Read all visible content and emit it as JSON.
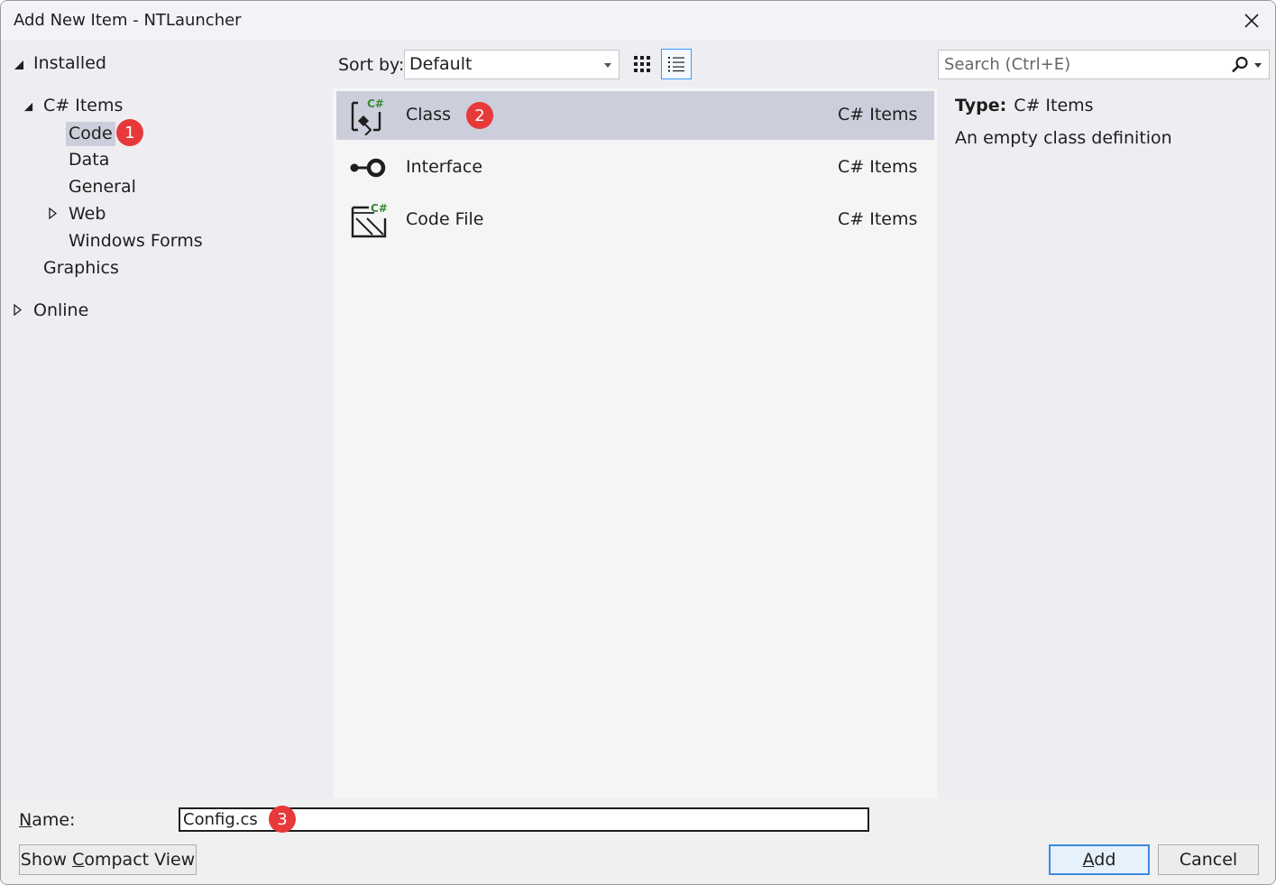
{
  "window": {
    "title": "Add New Item - NTLauncher"
  },
  "tree": {
    "installed": "Installed",
    "csharp_items": "C# Items",
    "code": "Code",
    "data": "Data",
    "general": "General",
    "web": "Web",
    "windows_forms": "Windows Forms",
    "graphics": "Graphics",
    "online": "Online"
  },
  "toolbar": {
    "sort_label": "Sort by:",
    "sort_value": "Default",
    "search_placeholder": "Search (Ctrl+E)"
  },
  "items": [
    {
      "name": "Class",
      "category": "C# Items",
      "icon": "class-icon",
      "selected": true
    },
    {
      "name": "Interface",
      "category": "C# Items",
      "icon": "interface-icon",
      "selected": false
    },
    {
      "name": "Code File",
      "category": "C# Items",
      "icon": "code-file-icon",
      "selected": false
    }
  ],
  "details": {
    "type_label": "Type:",
    "type_value": "C# Items",
    "description": "An empty class definition"
  },
  "footer": {
    "name_label": "Name:",
    "name_value": "Config.cs",
    "compact_view": "Show Compact View",
    "add": "Add",
    "cancel": "Cancel"
  },
  "badges": [
    "1",
    "2",
    "3"
  ],
  "colors": {
    "accent": "#3399ff",
    "selected_bg": "#cccedb",
    "badge": "#e8393a",
    "csharp_green": "#388a34"
  }
}
